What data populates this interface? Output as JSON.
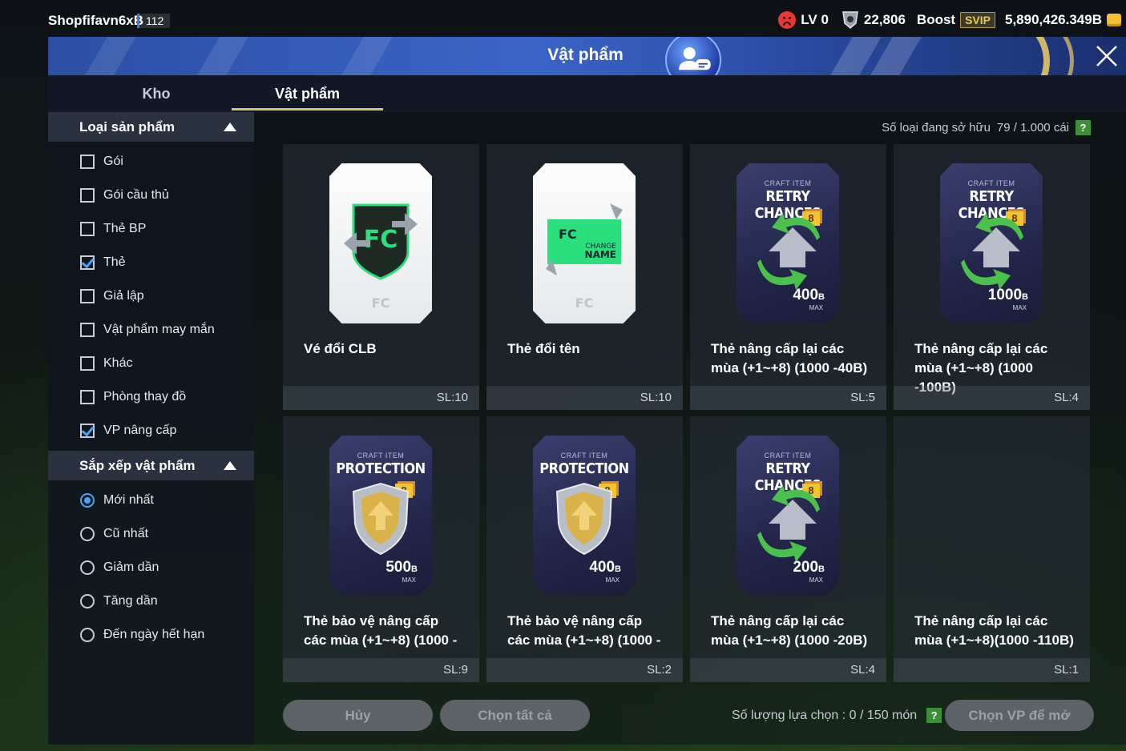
{
  "status_bar": {
    "player_name": "Shopfifavn6xB",
    "player_level": "112",
    "rank": "LV 0",
    "trophies": "22,806",
    "boost_label": "Boost",
    "svip_label": "SVIP",
    "coins": "5,890,426.349B",
    "icons": [
      "sad-face-icon",
      "shield-icon",
      "coin-stack-icon"
    ]
  },
  "header": {
    "title": "Vật phẩm",
    "close_icon": "close-icon"
  },
  "tabs": [
    {
      "label": "Kho",
      "active": false
    },
    {
      "label": "Vật phẩm",
      "active": true
    }
  ],
  "sidebar": {
    "product_type_title": "Loại sản phẩm",
    "product_types": [
      {
        "label": "Gói",
        "checked": false
      },
      {
        "label": "Gói cầu thủ",
        "checked": false
      },
      {
        "label": "Thẻ BP",
        "checked": false
      },
      {
        "label": "Thẻ",
        "checked": true
      },
      {
        "label": "Giả lập",
        "checked": false
      },
      {
        "label": "Vật phẩm may mắn",
        "checked": false
      },
      {
        "label": "Khác",
        "checked": false
      },
      {
        "label": "Phòng thay đồ",
        "checked": false
      },
      {
        "label": "VP nâng cấp",
        "checked": true
      }
    ],
    "sort_title": "Sắp xếp vật phẩm",
    "sort_options": [
      {
        "label": "Mới nhất",
        "selected": true
      },
      {
        "label": "Cũ nhất",
        "selected": false
      },
      {
        "label": "Giảm dần",
        "selected": false
      },
      {
        "label": "Tăng dần",
        "selected": false
      },
      {
        "label": "Đến ngày hết hạn",
        "selected": false
      }
    ]
  },
  "main": {
    "owned_label": "Số loại đang sở hữu",
    "owned_value": "79 / 1.000 cái",
    "help_label": "?",
    "items": [
      {
        "name": "Vé đổi CLB",
        "qty": "SL:10",
        "art": "white-club-ticket"
      },
      {
        "name": "Thẻ đổi tên",
        "qty": "SL:10",
        "art": "white-change-name",
        "art_text_1": "CHANGE",
        "art_text_2": "NAME"
      },
      {
        "name": "Thẻ nâng cấp lại các mùa (+1~+8) (1000 -40B)",
        "qty": "SL:5",
        "art": "dark-retry",
        "craft_label": "CRAFT ITEM",
        "craft_title": "RETRY CHANCES",
        "badge": "8",
        "cap": "400",
        "cap_unit": "B",
        "cap_max": "MAX"
      },
      {
        "name": "Thẻ nâng cấp lại các mùa (+1~+8) (1000 -100B)",
        "qty": "SL:4",
        "art": "dark-retry",
        "craft_label": "CRAFT ITEM",
        "craft_title": "RETRY CHANCES",
        "badge": "8",
        "cap": "1000",
        "cap_unit": "B",
        "cap_max": "MAX"
      },
      {
        "name": "Thẻ bảo vệ nâng cấp các mùa (+1~+8) (1000 -",
        "qty": "SL:9",
        "art": "dark-protection",
        "craft_label": "CRAFT ITEM",
        "craft_title": "PROTECTION",
        "badge": "8",
        "cap": "500",
        "cap_unit": "B",
        "cap_max": "MAX"
      },
      {
        "name": "Thẻ bảo vệ nâng cấp các mùa (+1~+8) (1000 -",
        "qty": "SL:2",
        "art": "dark-protection",
        "craft_label": "CRAFT ITEM",
        "craft_title": "PROTECTION",
        "badge": "8",
        "cap": "400",
        "cap_unit": "B",
        "cap_max": "MAX"
      },
      {
        "name": "Thẻ nâng cấp lại các mùa (+1~+8) (1000 -20B)",
        "qty": "SL:4",
        "art": "dark-retry",
        "craft_label": "CRAFT ITEM",
        "craft_title": "RETRY CHANCES",
        "badge": "8",
        "cap": "200",
        "cap_unit": "B",
        "cap_max": "MAX"
      },
      {
        "name": "Thẻ nâng cấp lại các mùa (+1~+8)(1000 -110B)",
        "qty": "SL:1",
        "art": "none"
      }
    ]
  },
  "footer": {
    "cancel_label": "Hủy",
    "select_all_label": "Chọn tất cả",
    "selection_label": "Số lượng lựa chọn : 0 / 150 món",
    "help_label": "?",
    "open_label": "Chọn VP để mở"
  }
}
